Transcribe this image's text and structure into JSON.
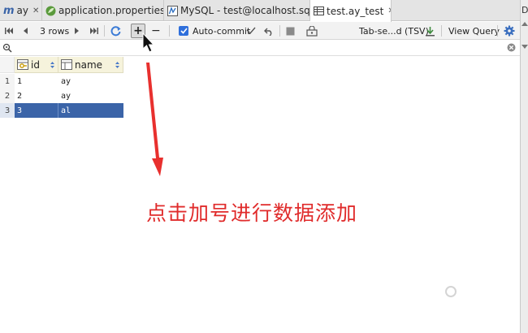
{
  "tabs": [
    {
      "label": "ay",
      "icon": "project-m-icon",
      "active": false
    },
    {
      "label": "application.properties",
      "icon": "spring-leaf-icon",
      "active": false
    },
    {
      "label": "MySQL - test@localhost.sql",
      "icon": "sql-console-icon",
      "active": false
    },
    {
      "label": "test.ay_test",
      "icon": "table-icon",
      "active": true
    }
  ],
  "right_strip_label": "D",
  "toolbar": {
    "rows_label": "3 rows",
    "autocommit_label": "Auto-commit",
    "format_label": "Tab-se...d (TSV)",
    "view_query_label": "View Query"
  },
  "grid": {
    "columns": [
      {
        "name": "id",
        "key": true
      },
      {
        "name": "name",
        "key": false
      }
    ],
    "rows": [
      {
        "num": "1",
        "id": "1",
        "name": "ay",
        "selected": false
      },
      {
        "num": "2",
        "id": "2",
        "name": "ay",
        "selected": false
      },
      {
        "num": "3",
        "id": "3",
        "name": "al",
        "selected": true
      }
    ]
  },
  "annotation_text": "点击加号进行数据添加",
  "colors": {
    "accent": "#2f6fdb",
    "selection": "#3b64a8",
    "header_bg": "#f6f3dc",
    "annotation": "#e02b2b"
  }
}
